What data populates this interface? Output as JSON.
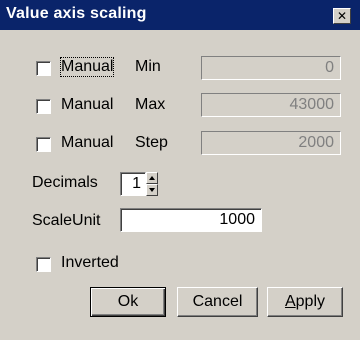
{
  "window": {
    "title": "Value axis scaling",
    "close_glyph": "✕"
  },
  "rows": {
    "min": {
      "checkbox_label": "Manual",
      "checked": false,
      "field_label": "Min",
      "value": "0"
    },
    "max": {
      "checkbox_label": "Manual",
      "checked": false,
      "field_label": "Max",
      "value": "43000"
    },
    "step": {
      "checkbox_label": "Manual",
      "checked": false,
      "field_label": "Step",
      "value": "2000"
    }
  },
  "decimals": {
    "label": "Decimals",
    "value": "1"
  },
  "scale_unit": {
    "label": "ScaleUnit",
    "value": "1000"
  },
  "inverted": {
    "label": "Inverted",
    "checked": false
  },
  "buttons": {
    "ok_label": "Ok",
    "cancel_label": "Cancel",
    "apply_prefix": "A",
    "apply_rest": "pply"
  },
  "colors": {
    "titlebar": "#0a246a",
    "dialog_bg": "#d4d0c8",
    "disabled_text": "#808080"
  }
}
